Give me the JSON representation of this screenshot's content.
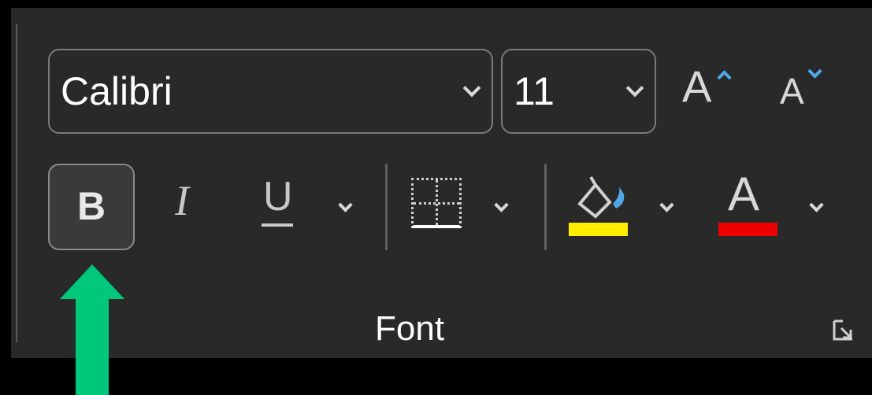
{
  "ribbon_group": {
    "label": "Font",
    "font_name": {
      "value": "Calibri"
    },
    "font_size": {
      "value": "11"
    },
    "increase_font_glyph": "A",
    "decrease_font_glyph": "A",
    "bold_glyph": "B",
    "italic_glyph": "I",
    "underline_glyph": "U",
    "font_color_glyph": "A",
    "colors": {
      "highlight": "#ffee00",
      "font_color": "#ee0000",
      "accent_arrow": "#00c87a",
      "caret": "#4ea8e6"
    },
    "icons": {
      "increase": "increase-font-size-icon",
      "decrease": "decrease-font-size-icon",
      "borders": "borders-icon",
      "fill": "fill-color-bucket-icon",
      "launcher": "dialog-launcher-icon"
    }
  },
  "annotation": {
    "pointer": "green-up-arrow",
    "target": "bold-button"
  }
}
